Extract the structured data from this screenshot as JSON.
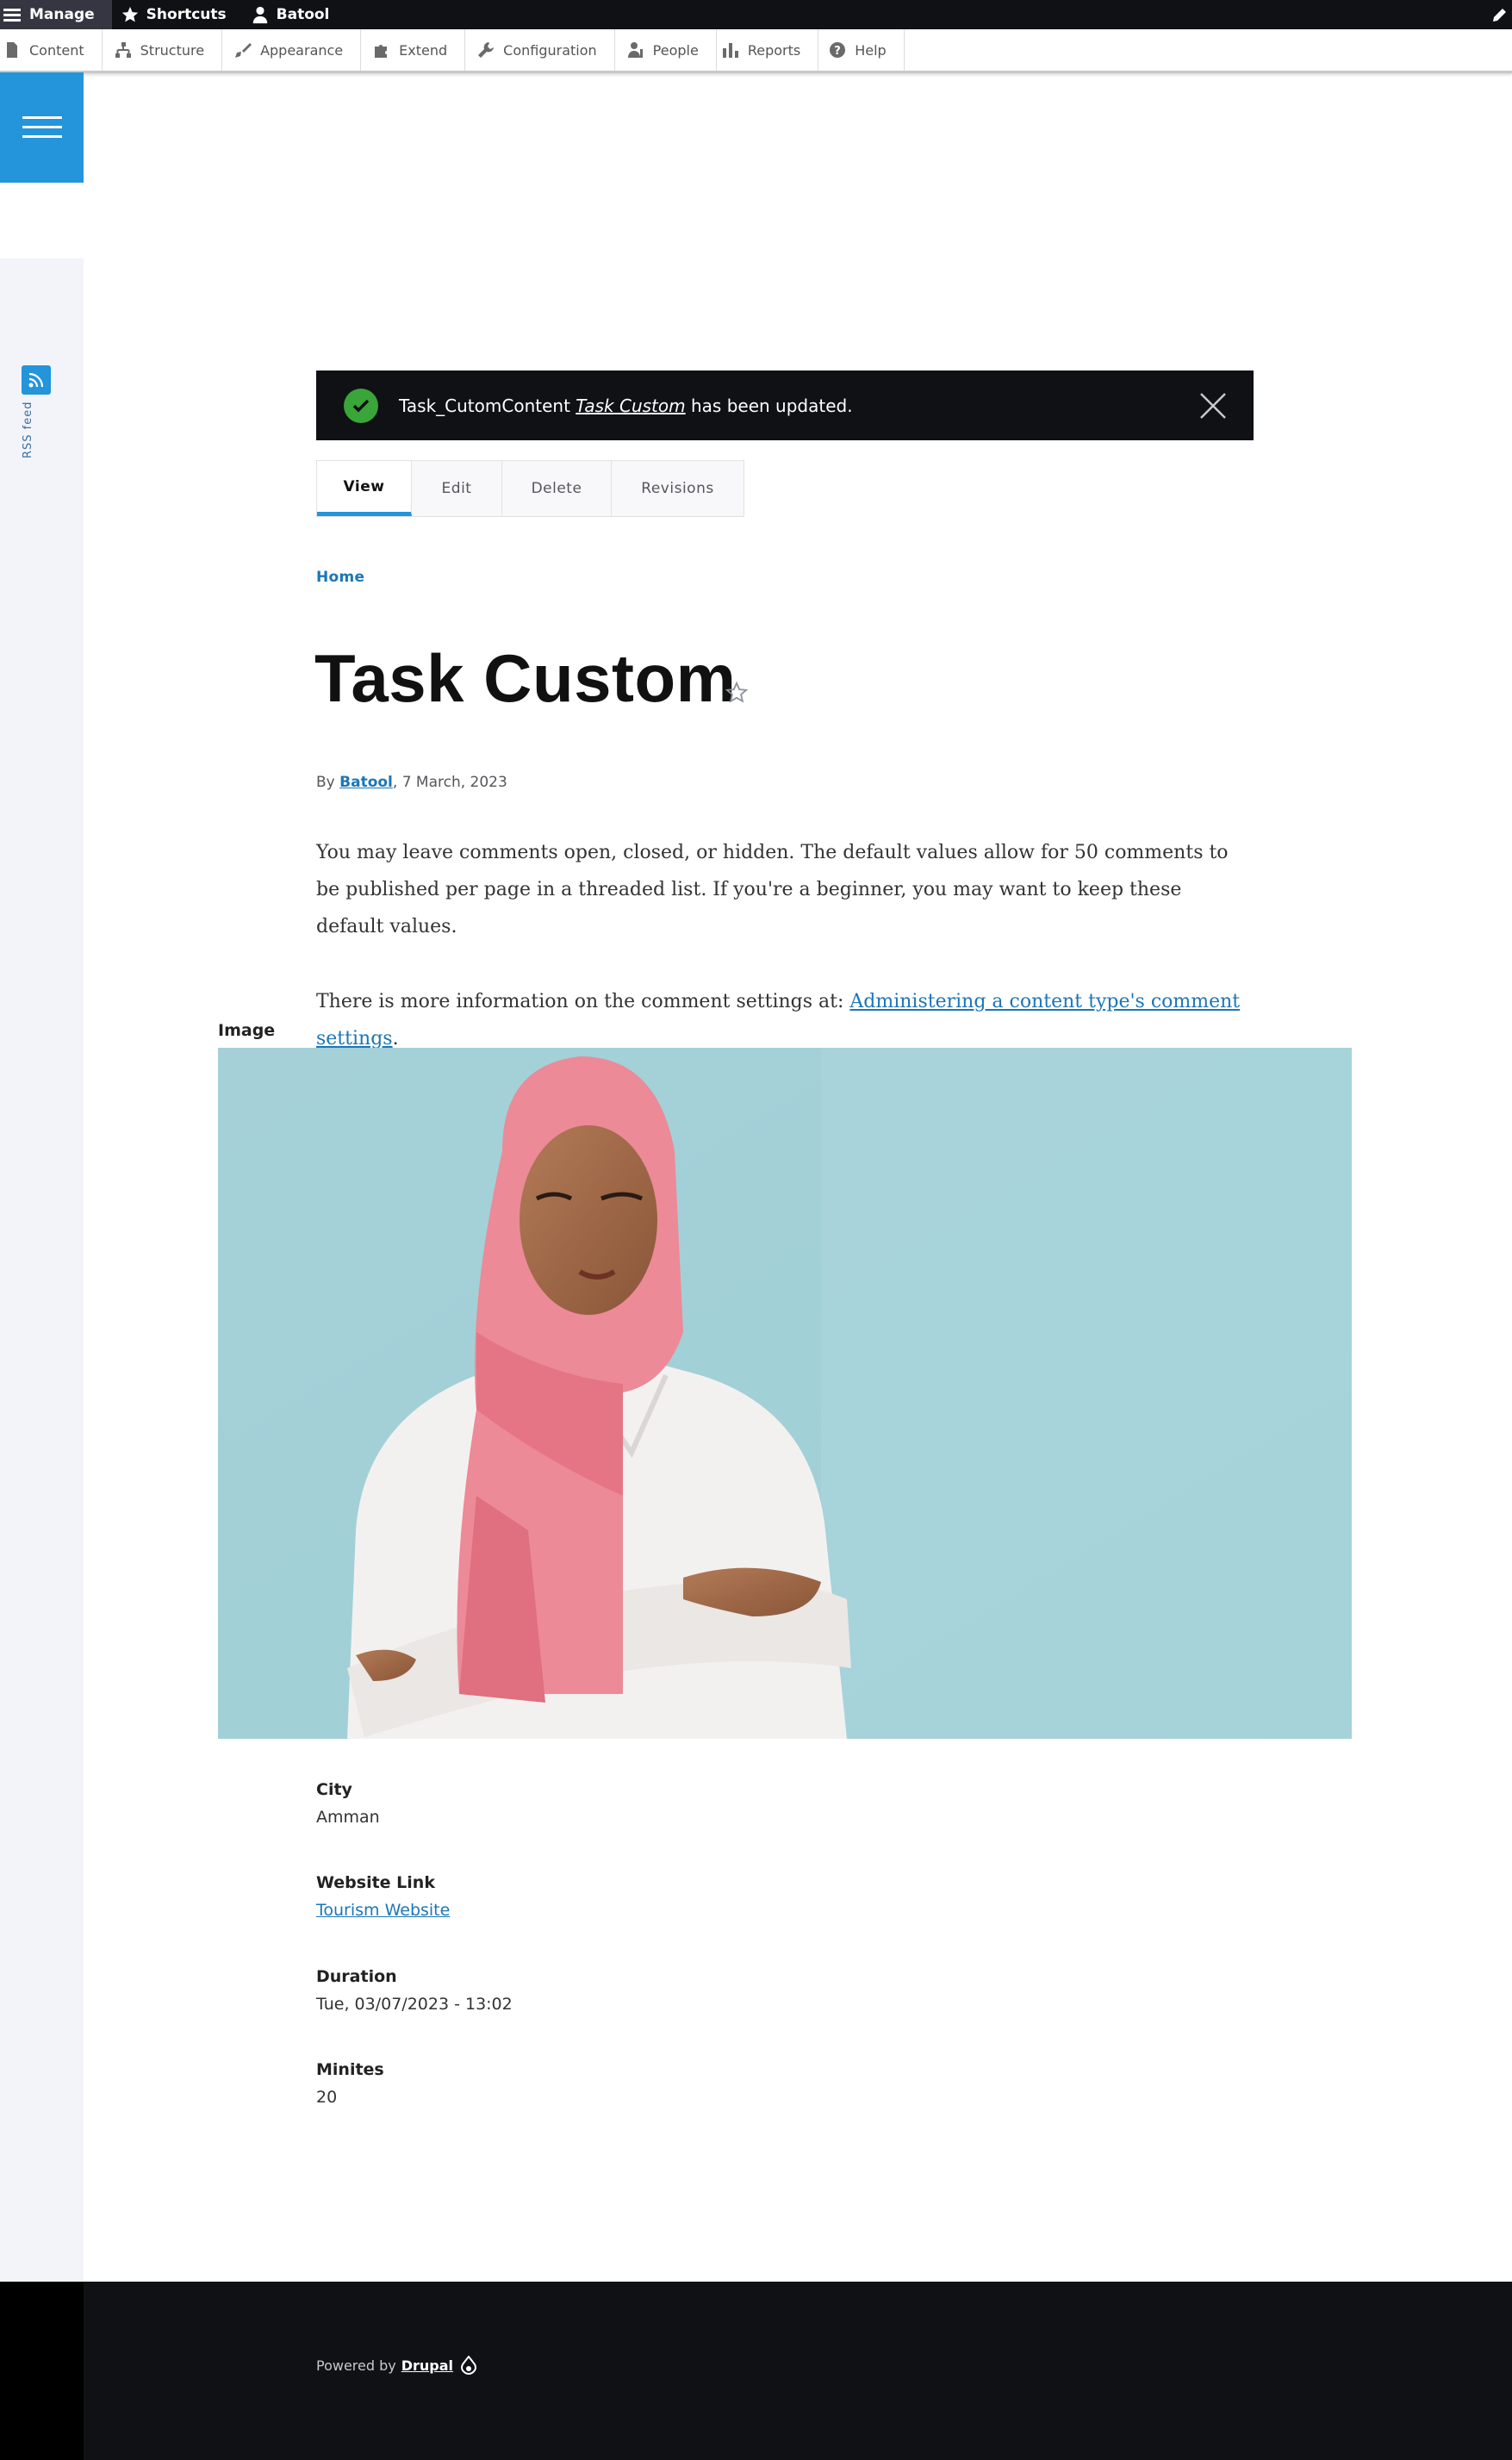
{
  "toolbar": {
    "manage": "Manage",
    "shortcuts": "Shortcuts",
    "user": "Batool"
  },
  "tray": {
    "items": [
      "Content",
      "Structure",
      "Appearance",
      "Extend",
      "Configuration",
      "People",
      "Reports",
      "Help"
    ]
  },
  "sidebar": {
    "rss_label": "RSS feed"
  },
  "status": {
    "prefix": "Task_CutomContent",
    "title": "Task Custom",
    "suffix": "has been updated."
  },
  "tabs": [
    "View",
    "Edit",
    "Delete",
    "Revisions"
  ],
  "breadcrumb": {
    "home": "Home"
  },
  "node": {
    "title": "Task Custom",
    "by": "By",
    "author": "Batool",
    "date": ", 7 March, 2023"
  },
  "body": {
    "p1": "You may leave comments open, closed, or hidden. The default values allow for 50 comments to be published per page in a threaded list. If you're a beginner, you may want to keep these default values.",
    "p2_prefix": "There is more information on the comment settings at: ",
    "p2_link": "Administering a content type's comment settings",
    "p2_suffix": "."
  },
  "fields": {
    "image_label": "Image",
    "city_label": "City",
    "city_value": "Amman",
    "website_label": "Website Link",
    "website_value": "Tourism Website",
    "duration_label": "Duration",
    "duration_value": "Tue, 03/07/2023 - 13:02",
    "minutes_label": "Minites",
    "minutes_value": "20"
  },
  "footer": {
    "powered_by": "Powered by",
    "drupal": "Drupal"
  },
  "colors": {
    "accent": "#2494db",
    "link": "#1b76b8",
    "dark": "#0f1115",
    "success": "#3aa538"
  }
}
